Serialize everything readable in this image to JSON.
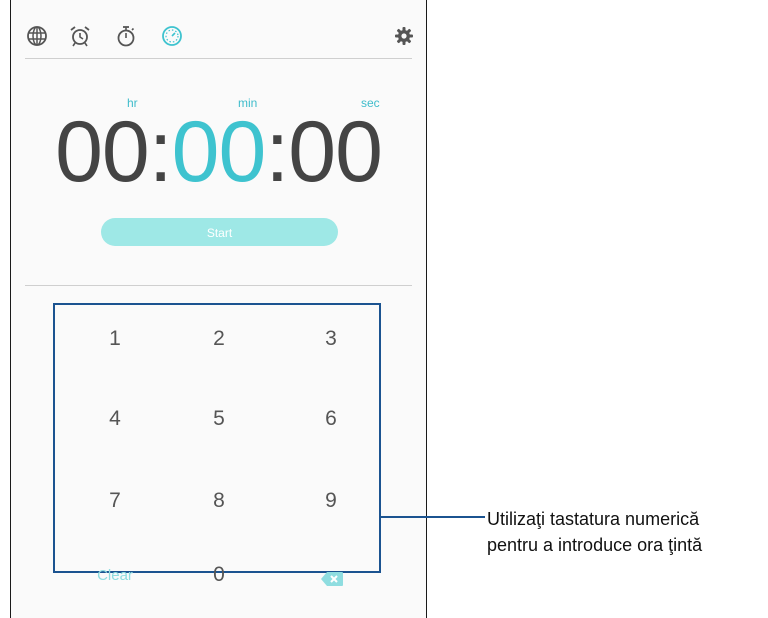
{
  "toolbar": {
    "icons": [
      "globe-icon",
      "alarm-icon",
      "stopwatch-icon",
      "timer-icon",
      "settings-icon"
    ],
    "active_color": "#3ec3cf"
  },
  "timer": {
    "units": {
      "hr": "hr",
      "min": "min",
      "sec": "sec"
    },
    "hours": "00",
    "minutes": "00",
    "seconds": "00",
    "separator": ":"
  },
  "start_label": "Start",
  "keypad": {
    "keys": [
      "1",
      "2",
      "3",
      "4",
      "5",
      "6",
      "7",
      "8",
      "9",
      "Clear",
      "0"
    ],
    "border_color": "#1b5390"
  },
  "callout": {
    "line1": "Utilizaţi tastatura numerică",
    "line2": "pentru a introduce ora ţintă"
  }
}
